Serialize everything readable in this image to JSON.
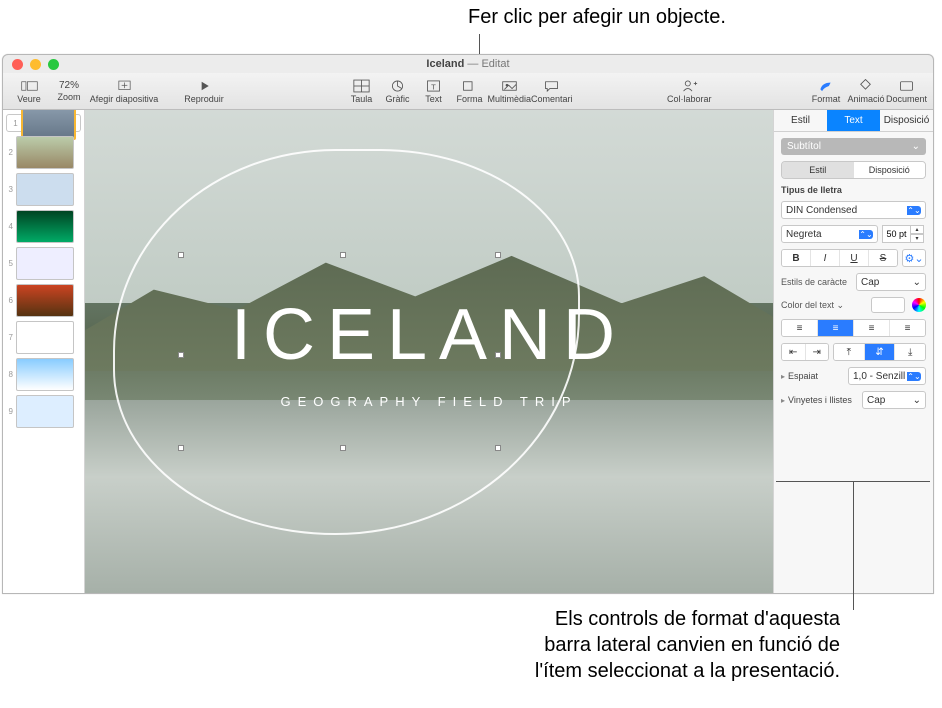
{
  "annotations": {
    "top": "Fer clic per afegir un objecte.",
    "bottom": "Els controls de format d'aquesta barra lateral canvien en funció de l'ítem seleccionat a la presentació."
  },
  "window": {
    "title_main": "Iceland",
    "title_suffix": " — Editat"
  },
  "toolbar": {
    "view": "Veure",
    "zoom_value": "72%",
    "zoom_label": "Zoom",
    "add_slide": "Afegir diapositiva",
    "play": "Reproduir",
    "insert": {
      "table": "Taula",
      "chart": "Gràfic",
      "text": "Text",
      "shape": "Forma",
      "media": "Multimèdia",
      "comment": "Comentari"
    },
    "collaborate": "Col·laborar",
    "format": "Format",
    "animate": "Animació",
    "document": "Document"
  },
  "slides": {
    "count": 9
  },
  "hero": {
    "title": "ICELAND",
    "subtitle": "GEOGRAPHY FIELD TRIP"
  },
  "inspector": {
    "tabs": {
      "style": "Estil",
      "text": "Text",
      "layout": "Disposició"
    },
    "paragraph_style": "Subtítol",
    "seg_style": "Estil",
    "seg_layout": "Disposició",
    "font_section": "Tipus de lletra",
    "font_family": "DIN Condensed",
    "font_weight": "Negreta",
    "font_size": "50 pt",
    "bold": "B",
    "italic": "I",
    "underline": "U",
    "strike": "S",
    "char_styles_label": "Estils de caràcte",
    "char_styles_value": "Cap",
    "text_color_label": "Color del text",
    "spacing_label": "Espaiat",
    "spacing_value": "1,0 - Senzill",
    "bullets_label": "Vinyetes i llistes",
    "bullets_value": "Cap"
  }
}
